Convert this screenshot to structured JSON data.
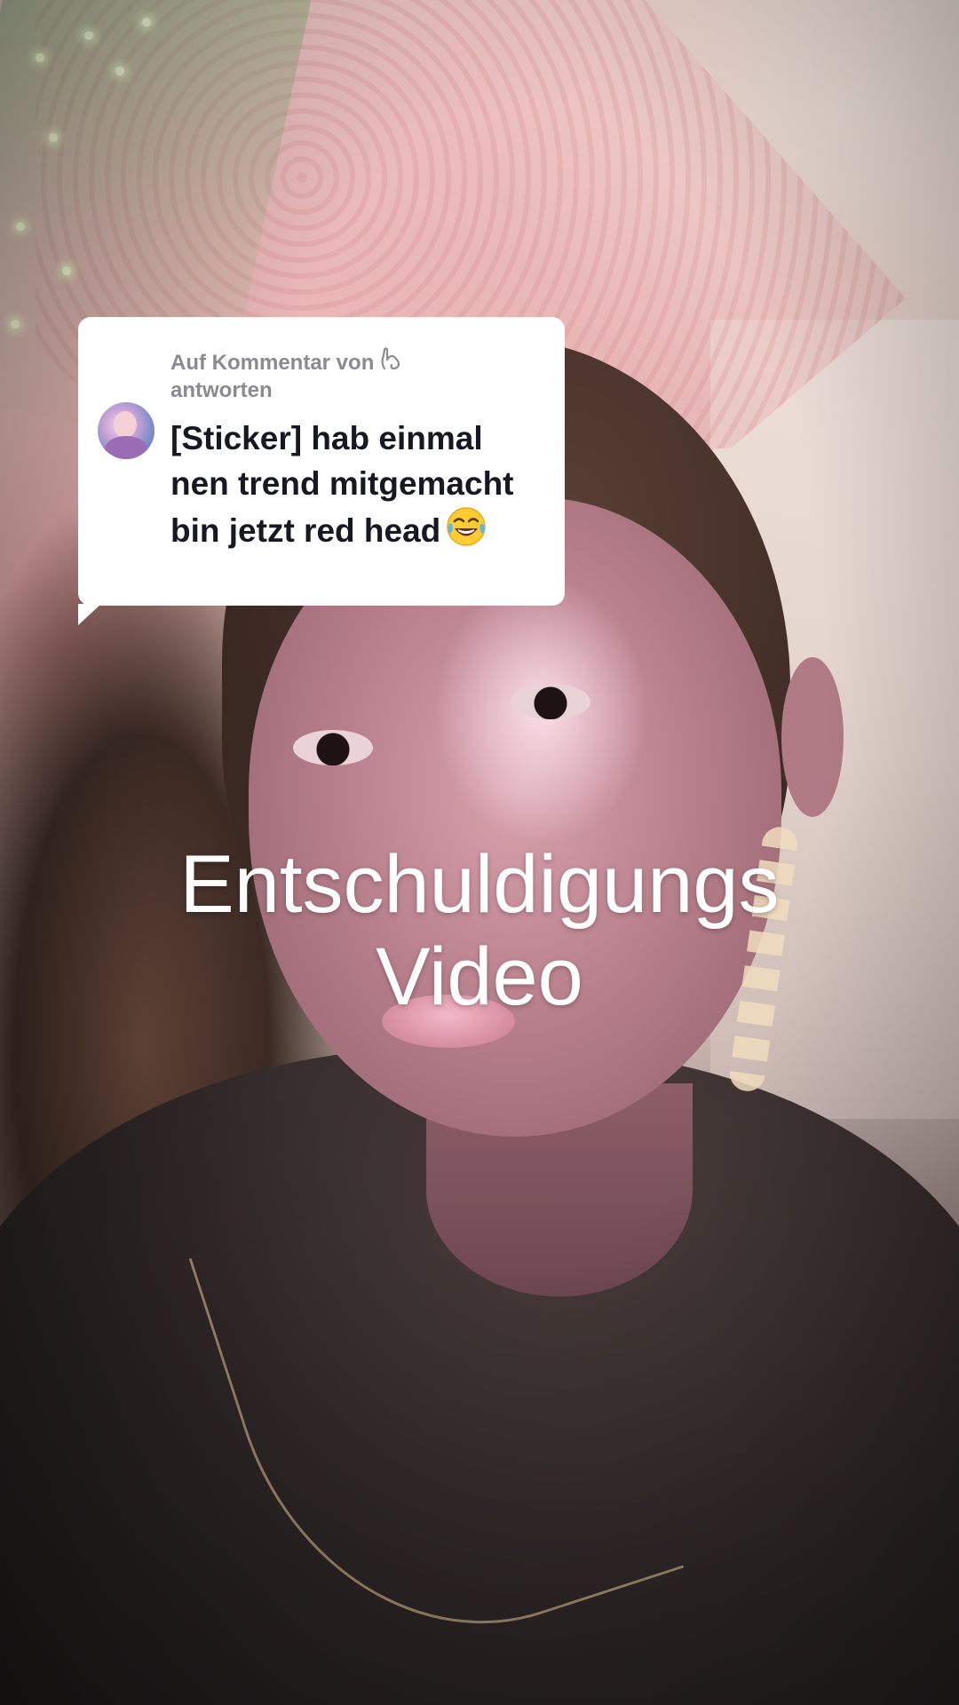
{
  "reply_card": {
    "header_line1": "Auf Kommentar von",
    "header_line2": "antworten",
    "comment_text": "[Sticker] hab einmal nen trend mitgemacht bin jetzt red head",
    "comment_emoji": "face-with-tears-of-joy",
    "username_icon": "hand-gesture-icon",
    "avatar": "commenter-avatar"
  },
  "overlay": {
    "caption_line1": "Entschuldigungs",
    "caption_line2": "Video"
  },
  "colors": {
    "card_background": "#ffffff",
    "card_header_text": "#8a8a8f",
    "card_body_text": "#161823",
    "caption_text": "#ffffff"
  }
}
